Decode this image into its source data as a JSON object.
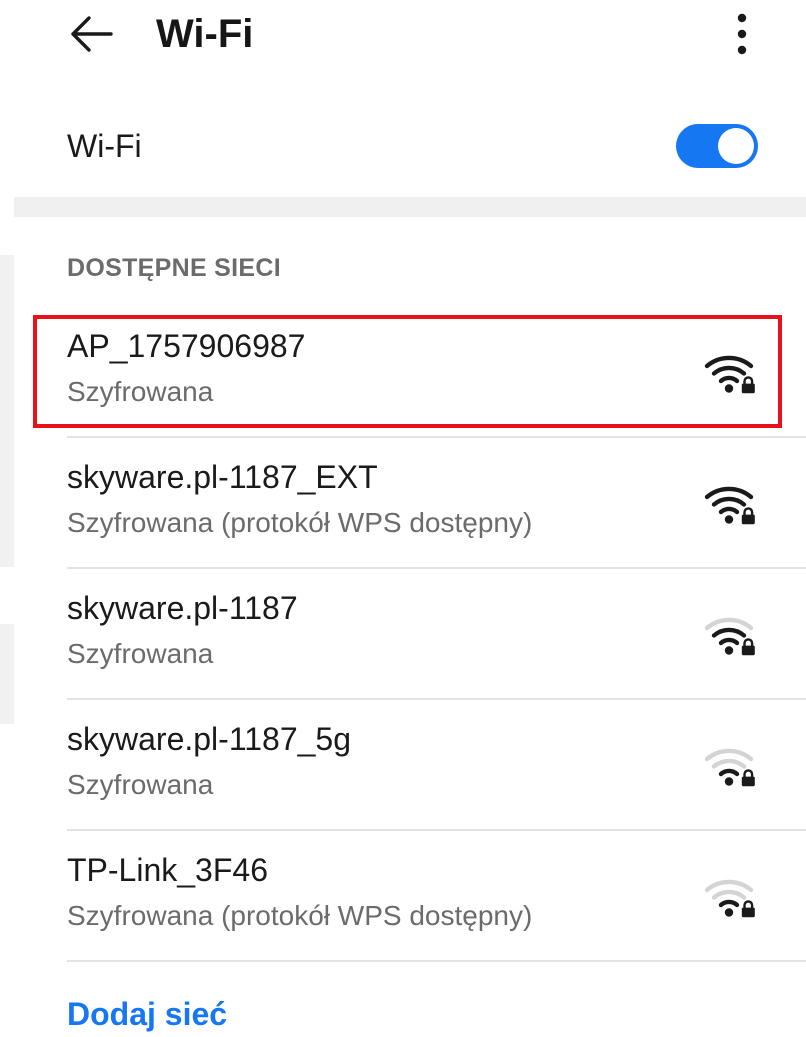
{
  "header": {
    "back_icon": "arrow-back-icon",
    "title": "Wi-Fi",
    "more_icon": "more-vertical-icon"
  },
  "wifi_toggle": {
    "label": "Wi-Fi",
    "enabled": true,
    "accent_color": "#1677f2"
  },
  "available_networks": {
    "header": "DOSTĘPNE SIECI",
    "items": [
      {
        "name": "AP_1757906987",
        "status": "Szyfrowana",
        "signal_bars": 4,
        "locked": true,
        "highlighted": true
      },
      {
        "name": "skyware.pl-1187_EXT",
        "status": "Szyfrowana (protokół WPS dostępny)",
        "signal_bars": 4,
        "locked": true,
        "highlighted": false
      },
      {
        "name": "skyware.pl-1187",
        "status": "Szyfrowana",
        "signal_bars": 3,
        "locked": true,
        "highlighted": false
      },
      {
        "name": "skyware.pl-1187_5g",
        "status": "Szyfrowana",
        "signal_bars": 2,
        "locked": true,
        "highlighted": false
      },
      {
        "name": "TP-Link_3F46",
        "status": "Szyfrowana (protokół WPS dostępny)",
        "signal_bars": 2,
        "locked": true,
        "highlighted": false
      }
    ]
  },
  "add_network": {
    "label": "Dodaj sieć"
  },
  "colors": {
    "highlight_border": "#e8101a",
    "signal_active": "#1a1a1a",
    "signal_inactive": "#d4d4d4",
    "link": "#1677f2"
  }
}
